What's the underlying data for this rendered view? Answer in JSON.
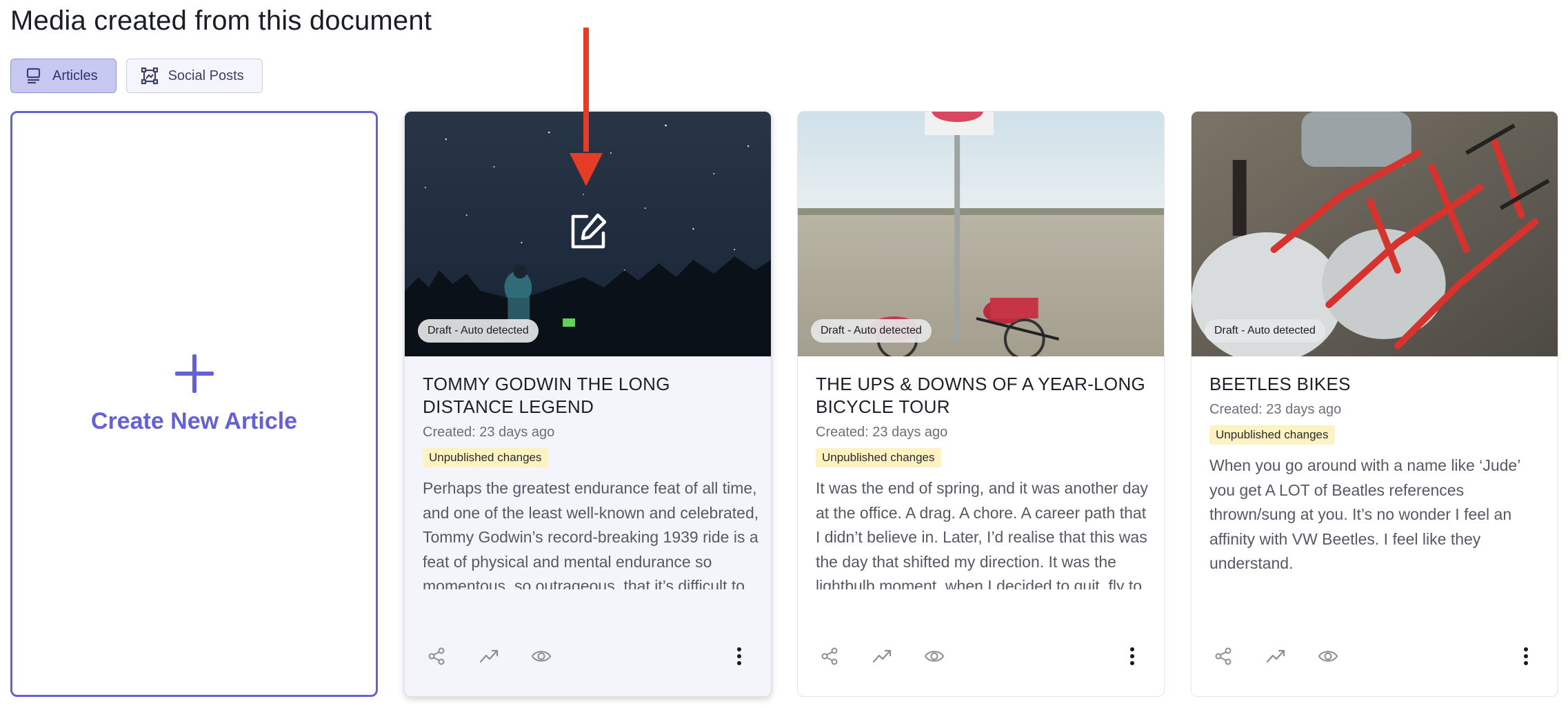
{
  "page": {
    "title": "Media created from this document"
  },
  "tabs": [
    {
      "label": "Articles",
      "icon": "article-icon",
      "active": true
    },
    {
      "label": "Social Posts",
      "icon": "social-posts-icon",
      "active": false
    }
  ],
  "create": {
    "label": "Create New Article",
    "icon": "plus-icon"
  },
  "cards": [
    {
      "title": "TOMMY GODWIN THE LONG DISTANCE LEGEND",
      "created": "Created: 23 days ago",
      "status": "Unpublished changes",
      "draft_badge": "Draft - Auto detected",
      "image": "night sky cyclist photo",
      "excerpt": "Perhaps the greatest endurance feat of all time, and one of the least well-known and celebrated, Tommy Godwin’s record-breaking 1939 ride is a feat of physical and mental endurance so momentous, so outrageous, that it’s difficult to fully comprehend what the"
    },
    {
      "title": "THE UPS & DOWNS OF A YEAR-LONG BICYCLE TOUR",
      "created": "Created: 23 days ago",
      "status": "Unpublished changes",
      "draft_badge": "Draft - Auto detected",
      "image": "bicycle in flat field with stop sign photo",
      "excerpt": "It was the end of spring, and it was another day at the office. A drag. A chore. A career path that I didn’t believe in. Later, I’d realise that this was the day that shifted my direction. It was the lightbulb moment, when I decided to quit, fly to New York and set off"
    },
    {
      "title": "BEETLES BIKES",
      "created": "Created: 23 days ago",
      "status": "Unpublished changes",
      "draft_badge": "Draft - Auto detected",
      "image": "red rental bikes and VW Beetle photo",
      "excerpt": "When you go around with a name like ‘Jude’ you get A LOT of Beatles references thrown/sung at you. It’s no wonder I feel an affinity with VW Beetles. I feel like they understand."
    }
  ],
  "card_actions": [
    "share-icon",
    "analytics-icon",
    "preview-icon",
    "more-options-icon"
  ],
  "colors": {
    "accent": "#6461d6",
    "annotation_arrow": "#e63c25",
    "unpublished_bg": "#fdf3c2"
  }
}
